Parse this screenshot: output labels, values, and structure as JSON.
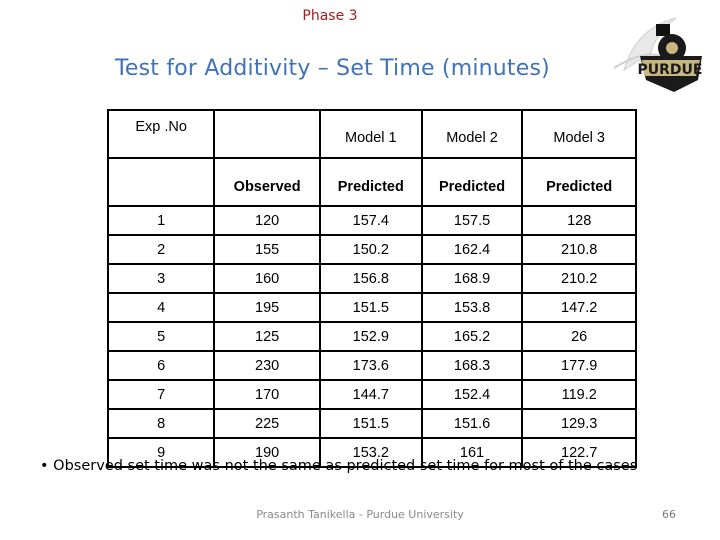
{
  "header": {
    "phase": "Phase 3",
    "title": "Test for Additivity – Set Time (minutes)"
  },
  "logo": {
    "icon": "purdue-train-logo-icon",
    "text": "PURDUE"
  },
  "table": {
    "header_row1": [
      "Exp .No",
      "",
      "Model 1",
      "Model 2",
      "Model 3"
    ],
    "header_row2": [
      "",
      "Observed",
      "Predicted",
      "Predicted",
      "Predicted"
    ],
    "rows": [
      [
        "1",
        "120",
        "157.4",
        "157.5",
        "128"
      ],
      [
        "2",
        "155",
        "150.2",
        "162.4",
        "210.8"
      ],
      [
        "3",
        "160",
        "156.8",
        "168.9",
        "210.2"
      ],
      [
        "4",
        "195",
        "151.5",
        "153.8",
        "147.2"
      ],
      [
        "5",
        "125",
        "152.9",
        "165.2",
        "26"
      ],
      [
        "6",
        "230",
        "173.6",
        "168.3",
        "177.9"
      ],
      [
        "7",
        "170",
        "144.7",
        "152.4",
        "119.2"
      ],
      [
        "8",
        "225",
        "151.5",
        "151.6",
        "129.3"
      ],
      [
        "9",
        "190",
        "153.2",
        "161",
        "122.7"
      ]
    ]
  },
  "bullet": "• Observed set time was not the same as predicted set time for most of the cases",
  "footer": {
    "author": "Prasanth Tanikella - Purdue University",
    "page_number": "66"
  },
  "colors": {
    "phase": "#a31c1c",
    "title": "#3f72b8",
    "logo_gold": "#c8b680"
  }
}
